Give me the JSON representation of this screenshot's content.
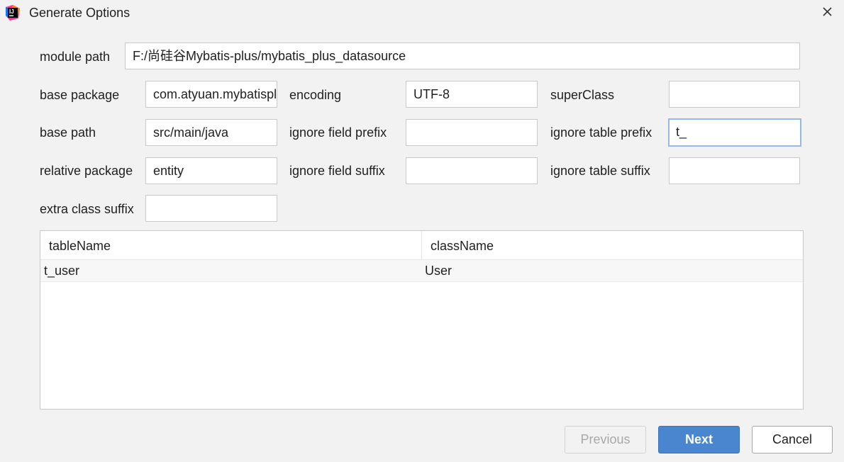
{
  "window": {
    "title": "Generate Options",
    "app_icon": "intellij-idea-icon",
    "close_icon": "close-icon"
  },
  "form": {
    "module_path": {
      "label": "module path",
      "value": "F:/尚硅谷Mybatis-plus/mybatis_plus_datasource"
    },
    "base_package": {
      "label": "base package",
      "value": "com.atyuan.mybatisplus"
    },
    "encoding": {
      "label": "encoding",
      "value": "UTF-8"
    },
    "super_class": {
      "label": "superClass",
      "value": ""
    },
    "base_path": {
      "label": "base path",
      "value": "src/main/java"
    },
    "ignore_field_prefix": {
      "label": "ignore field prefix",
      "value": ""
    },
    "ignore_table_prefix": {
      "label": "ignore table prefix",
      "value": "t_"
    },
    "relative_package": {
      "label": "relative package",
      "value": "entity"
    },
    "ignore_field_suffix": {
      "label": "ignore field suffix",
      "value": ""
    },
    "ignore_table_suffix": {
      "label": "ignore table suffix",
      "value": ""
    },
    "extra_class_suffix": {
      "label": "extra class suffix",
      "value": ""
    }
  },
  "table": {
    "headers": [
      "tableName",
      "className"
    ],
    "rows": [
      [
        "t_user",
        "User"
      ]
    ]
  },
  "buttons": {
    "previous": "Previous",
    "next": "Next",
    "cancel": "Cancel"
  },
  "colors": {
    "background": "#f2f2f2",
    "primary_button": "#4a86d0",
    "focus_border": "#99b8ea"
  }
}
